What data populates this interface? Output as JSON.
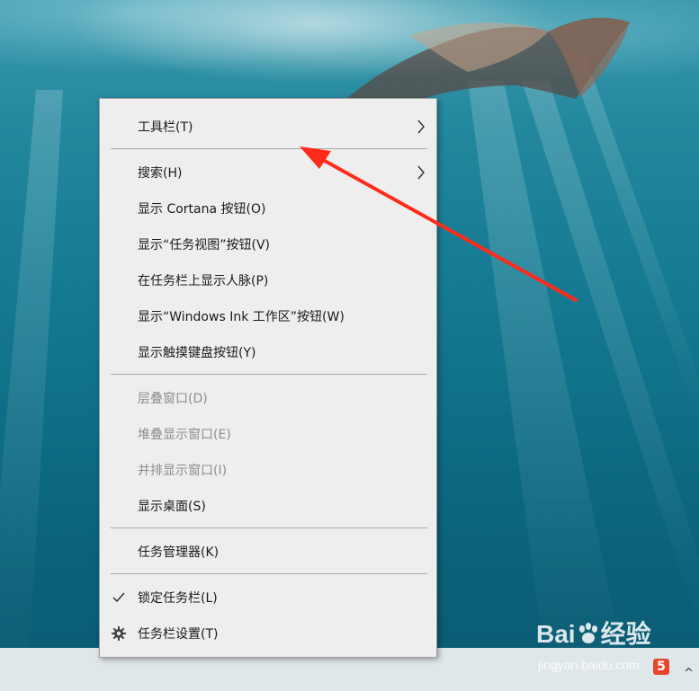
{
  "menu": {
    "toolbars": "工具栏(T)",
    "search": "搜索(H)",
    "show_cortana": "显示 Cortana 按钮(O)",
    "show_task_view": "显示“任务视图”按钮(V)",
    "show_people": "在任务栏上显示人脉(P)",
    "show_ink": "显示“Windows Ink 工作区”按钮(W)",
    "show_touch_keyboard": "显示触摸键盘按钮(Y)",
    "cascade": "层叠窗口(D)",
    "stacked": "堆叠显示窗口(E)",
    "side_by_side": "并排显示窗口(I)",
    "show_desktop": "显示桌面(S)",
    "task_manager": "任务管理器(K)",
    "lock_taskbar": "锁定任务栏(L)",
    "taskbar_settings": "任务栏设置(T)"
  },
  "watermark": {
    "logo_left": "Bai",
    "logo_right": "经验",
    "url": "jingyan.baidu.com",
    "badge": "5"
  },
  "taskbar": {
    "tray_glyph": "^"
  },
  "colors": {
    "menu_background": "#eeeeee",
    "menu_text": "#1a1a1a",
    "disabled_text": "#8d8d8d",
    "separator": "#a8a8a8",
    "annotation_arrow": "#ff2a1a",
    "taskbar": "#dfe7ea"
  },
  "icons": {
    "submenu": "chevron-right-icon",
    "lock_taskbar": "checkmark-icon",
    "taskbar_settings": "gear-icon"
  }
}
